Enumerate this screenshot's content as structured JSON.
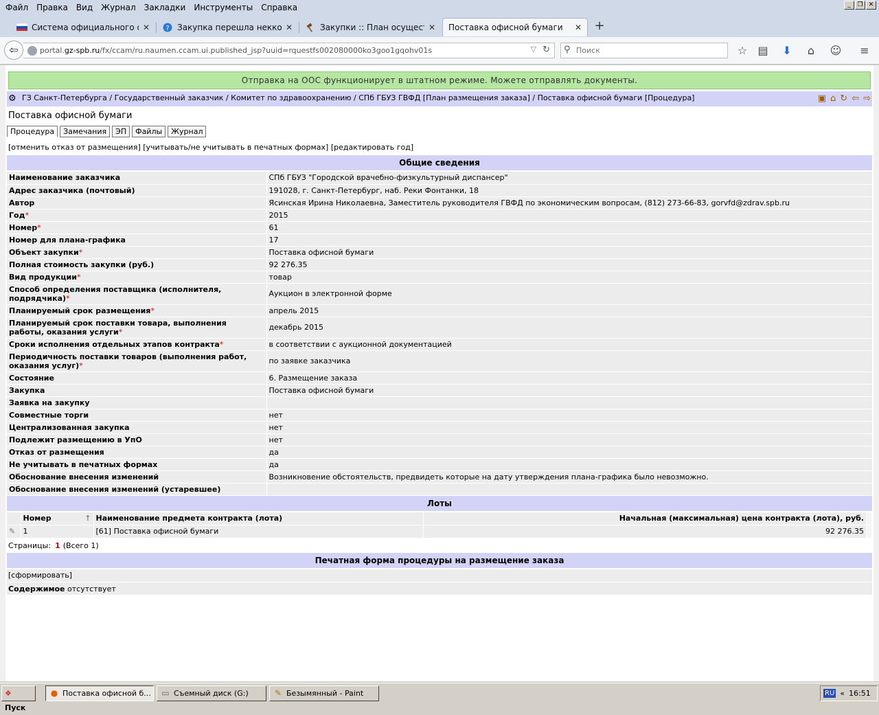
{
  "menu": [
    "Файл",
    "Правка",
    "Вид",
    "Журнал",
    "Закладки",
    "Инструменты",
    "Справка"
  ],
  "tabs": [
    {
      "title": "Система официального опу...",
      "icon": "flag-icon"
    },
    {
      "title": "Закупка перешла неккорек...",
      "icon": "question-icon"
    },
    {
      "title": "Закупки :: План осуществл...",
      "icon": "gavel-icon"
    },
    {
      "title": "Поставка офисной бумаги",
      "icon": ""
    }
  ],
  "url": {
    "prefix": "portal.",
    "host": "gz-spb.ru",
    "path": "/fx/ccam/ru.naumen.ccam.ui.published_jsp?uuid=rquestfs002080000ko3goo1gqohv01s"
  },
  "search": {
    "placeholder": "Поиск"
  },
  "status_banner": "Отправка на ООС функционирует в штатном режиме. Можете отправлять документы.",
  "breadcrumb": "ГЗ Санкт-Петербурга / Государственный заказчик / Комитет по здравоохранению / СПб ГБУЗ ГВФД [План размещения заказа] / Поставка офисной бумаги [Процедура]",
  "page_title": "Поставка офисной бумаги",
  "subtabs": [
    "Процедура",
    "Замечания",
    "ЭП",
    "Файлы",
    "Журнал"
  ],
  "actions": "[отменить отказ от размещения] [учитывать/не учитывать в печатных формах] [редактировать год]",
  "general": {
    "header": "Общие сведения",
    "rows": [
      {
        "label": "Наименование заказчика",
        "value": "СПб ГБУЗ \"Городской врачебно-физкультурный диспансер\""
      },
      {
        "label": "Адрес заказчика (почтовый)",
        "value": "191028, г. Санкт-Петербург, наб. Реки Фонтанки, 18"
      },
      {
        "label": "Автор",
        "value": "Ясинская Ирина Николаевна, Заместитель руководителя ГВФД по экономическим вопросам, (812) 273-66-83, gorvfd@zdrav.spb.ru"
      },
      {
        "label": "Год",
        "value": "2015",
        "req": true
      },
      {
        "label": "Номер",
        "value": "61",
        "req": true
      },
      {
        "label": "Номер для плана-графика",
        "value": "17"
      },
      {
        "label": "Объект закупки",
        "value": "Поставка офисной бумаги",
        "req": true
      },
      {
        "label": "Полная стоимость закупки (руб.)",
        "value": "92 276.35"
      },
      {
        "label": "Вид продукции",
        "value": "товар",
        "req": true
      },
      {
        "label": "Способ определения поставщика (исполнителя, подрядчика)",
        "value": "Аукцион в электронной форме",
        "req": true,
        "tall": true
      },
      {
        "label": "Планируемый срок размещения",
        "value": "апрель 2015",
        "req": true
      },
      {
        "label": "Планируемый срок поставки товара, выполнения работы, оказания услуги",
        "value": "декабрь 2015",
        "req": true,
        "tall": true
      },
      {
        "label": "Сроки исполнения отдельных этапов контракта",
        "value": "в соответствии с аукционной документацией",
        "req": true
      },
      {
        "label": "Периодичность поставки товаров (выполнения работ, оказания услуг)",
        "value": "по заявке заказчика",
        "req": true,
        "tall": true
      },
      {
        "label": "Состояние",
        "value": "6. Размещение заказа"
      },
      {
        "label": "Закупка",
        "value": "Поставка офисной бумаги"
      },
      {
        "label": "Заявка на закупку",
        "value": ""
      },
      {
        "label": "Совместные торги",
        "value": "нет"
      },
      {
        "label": "Централизованная закупка",
        "value": "нет"
      },
      {
        "label": "Подлежит размещению в УпО",
        "value": "нет"
      },
      {
        "label": "Отказ от размещения",
        "value": "да"
      },
      {
        "label": "Не учитывать в печатных формах",
        "value": "да"
      },
      {
        "label": "Обоснование внесения изменений",
        "value": "Возникновение обстоятельств, предвидеть которые на дату утверждения плана-графика было невозможно."
      },
      {
        "label": "Обоснование внесения изменений (устаревшее)",
        "value": ""
      }
    ]
  },
  "lots": {
    "header": "Лоты",
    "columns": [
      "Номер",
      "Наименование предмета контракта (лота)",
      "Начальная (максимальная) цена контракта (лота), руб."
    ],
    "rows": [
      {
        "num": "1",
        "name": "[61] Поставка офисной бумаги",
        "price": "92 276.35"
      }
    ],
    "pager_label": "Страницы:",
    "pager_current": "1",
    "pager_total": "(Всего 1)"
  },
  "print_form": {
    "header": "Печатная форма процедуры на размещение заказа",
    "action": "[сформировать]",
    "content_label": "Содержимое",
    "content_value": "отсутствует"
  },
  "taskbar": {
    "start": "Пуск",
    "tasks": [
      {
        "title": "Поставка офисной б...",
        "icon": "firefox-icon"
      },
      {
        "title": "Съемный диск (G:)",
        "icon": "drive-icon"
      },
      {
        "title": "Безымянный - Paint",
        "icon": "paint-icon"
      }
    ],
    "lang": "RU",
    "clock": "16:51"
  }
}
